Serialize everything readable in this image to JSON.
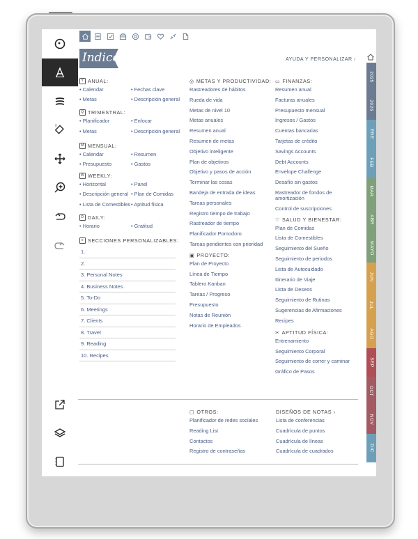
{
  "toolbar": {
    "items": [
      {
        "name": "pen-status-icon",
        "glyph": "☉"
      },
      {
        "name": "text-tool-icon",
        "glyph": "A"
      },
      {
        "name": "menu-icon",
        "glyph": "≡"
      },
      {
        "name": "eraser-icon",
        "glyph": "✐"
      },
      {
        "name": "move-icon",
        "glyph": "✥"
      },
      {
        "name": "zoom-icon",
        "glyph": "⊕"
      },
      {
        "name": "undo-icon",
        "glyph": "↶"
      },
      {
        "name": "redo-icon",
        "glyph": "↷"
      },
      {
        "name": "share-icon",
        "glyph": "↗"
      },
      {
        "name": "layers-icon",
        "glyph": "◈"
      },
      {
        "name": "pages-icon",
        "glyph": "▯"
      }
    ]
  },
  "nav_icons": [
    "home-icon",
    "notes-icon",
    "checklist-icon",
    "briefcase-icon",
    "goals-icon",
    "wallet-icon",
    "heart-icon",
    "fitness-icon",
    "document-icon"
  ],
  "header": {
    "title": "Indice",
    "help": "AYUDA Y PERSONALIZAR ›"
  },
  "tabs": [
    {
      "label": "2025",
      "color": "#6b7c92"
    },
    {
      "label": "2026",
      "color": "#6b7c92"
    },
    {
      "label": "ENE",
      "color": "#6da0b8"
    },
    {
      "label": "FEB",
      "color": "#6da0b8"
    },
    {
      "label": "MAR",
      "color": "#7fa07a"
    },
    {
      "label": "ABR",
      "color": "#7fa07a"
    },
    {
      "label": "MAYO",
      "color": "#7fa07a"
    },
    {
      "label": "JUN",
      "color": "#d6a14e"
    },
    {
      "label": "JUL",
      "color": "#d6a14e"
    },
    {
      "label": "AGO",
      "color": "#d6a14e"
    },
    {
      "label": "SEP",
      "color": "#b04e55"
    },
    {
      "label": "OCT",
      "color": "#a35a62"
    },
    {
      "label": "NOV",
      "color": "#a35a62"
    },
    {
      "label": "DIC",
      "color": "#6da0b8"
    }
  ],
  "col1": {
    "anual": {
      "title": "ANUAL:",
      "items": [
        "• Calendar",
        "• Fechas clave",
        "• Metas",
        "• Descripción general"
      ]
    },
    "trimestral": {
      "title": "TRIMESTRAL:",
      "items": [
        "• Planificador",
        "• Enfocar",
        "• Metas",
        "• Descripción general"
      ]
    },
    "mensual": {
      "title": "MENSUAL:",
      "items": [
        "• Calendar",
        "• Resumen",
        "• Presupuesto",
        "• Gastos"
      ]
    },
    "weekly": {
      "title": "WEEKLY:",
      "items": [
        "• Horizontal",
        "• Panel",
        "• Descripción general",
        "• Plan de Comidas",
        "• Lista de Comestibles",
        "• Aptitud física"
      ]
    },
    "daily": {
      "title": "DAILY:",
      "items": [
        "• Horario",
        "• Gratitud"
      ]
    },
    "secciones": {
      "title": "SECCIONES PERSONALIZABLES:",
      "items": [
        "1.",
        "2.",
        "3. Personal Notes",
        "4. Business Notes",
        "5. To-Do",
        "6. Meetings",
        "7. Clients",
        "8. Travel",
        "9. Reading",
        "10. Recipes"
      ]
    }
  },
  "col2": {
    "metas": {
      "title": "METAS Y PRODUCTIVIDAD:",
      "items": [
        "Rastreadores de hábitos",
        "Rueda de vida",
        "Metas de nivel 10",
        "Metas anuales",
        "Resumen anual",
        "Resumen de metas",
        "Objetivo inteligente",
        "Plan de objetivos",
        "Objetivo y pasos de acción",
        "Terminar las cosas",
        "Bandeja de entrada de ideas",
        "Tareas personales",
        "Registro tiempo de trabajo",
        "Rastreador de tiempo",
        "Planificador Pomodoro",
        "Tareas pendientes con prioridad"
      ]
    },
    "proyecto": {
      "title": "PROYECTO:",
      "items": [
        "Plan de Proyecto",
        "Línea de Tiempo",
        "Tablero Kanban",
        "Tareas / Progreso",
        "Presupuesto",
        "Notas de Reunión",
        "Horario de Empleados"
      ]
    },
    "otros": {
      "title": "OTROS:",
      "items": [
        "Planificador de redes sociales",
        "Reading List",
        "Contactos",
        "Registro de contraseñas"
      ]
    }
  },
  "col3": {
    "finanzas": {
      "title": "FINANZAS:",
      "items": [
        "Resumen anual",
        "Facturas anuales",
        "Presupuesto mensual",
        "Ingresos / Gastos",
        "Cuentas bancarias",
        "Tarjetas de crédito",
        "Savings Accounts",
        "Debt Accounts",
        "Envelope Challenge",
        "Desafío sin gastos",
        "Rastreador de fondos de amortización",
        "Control de suscripciones"
      ]
    },
    "salud": {
      "title": "SALUD Y BIENESTAR:",
      "items": [
        "Plan de Comidas",
        "Lista de Comestibles",
        "Seguimiento del Sueño",
        "Seguimiento de periodos",
        "Lista de Autocuidado",
        "Itinerario de Viaje",
        "Lista de Deseos",
        "Seguimiento de Rutinas",
        "Sugerencias de Afirmaciones",
        "Recipes"
      ]
    },
    "aptitud": {
      "title": "APTITUD FÍSICA:",
      "items": [
        "Entrenamiento",
        "Seguimiento Corporal",
        "Seguimiento de correr y caminar",
        "Gráfico de Pasos"
      ]
    },
    "disenos": {
      "title": "DISEÑOS DE NOTAS ›",
      "items": [
        "Lista de conferencias",
        "Cuadrícula de puntos",
        "Cuadrícula de líneas",
        "Cuadrícula de cuadrados"
      ]
    }
  }
}
